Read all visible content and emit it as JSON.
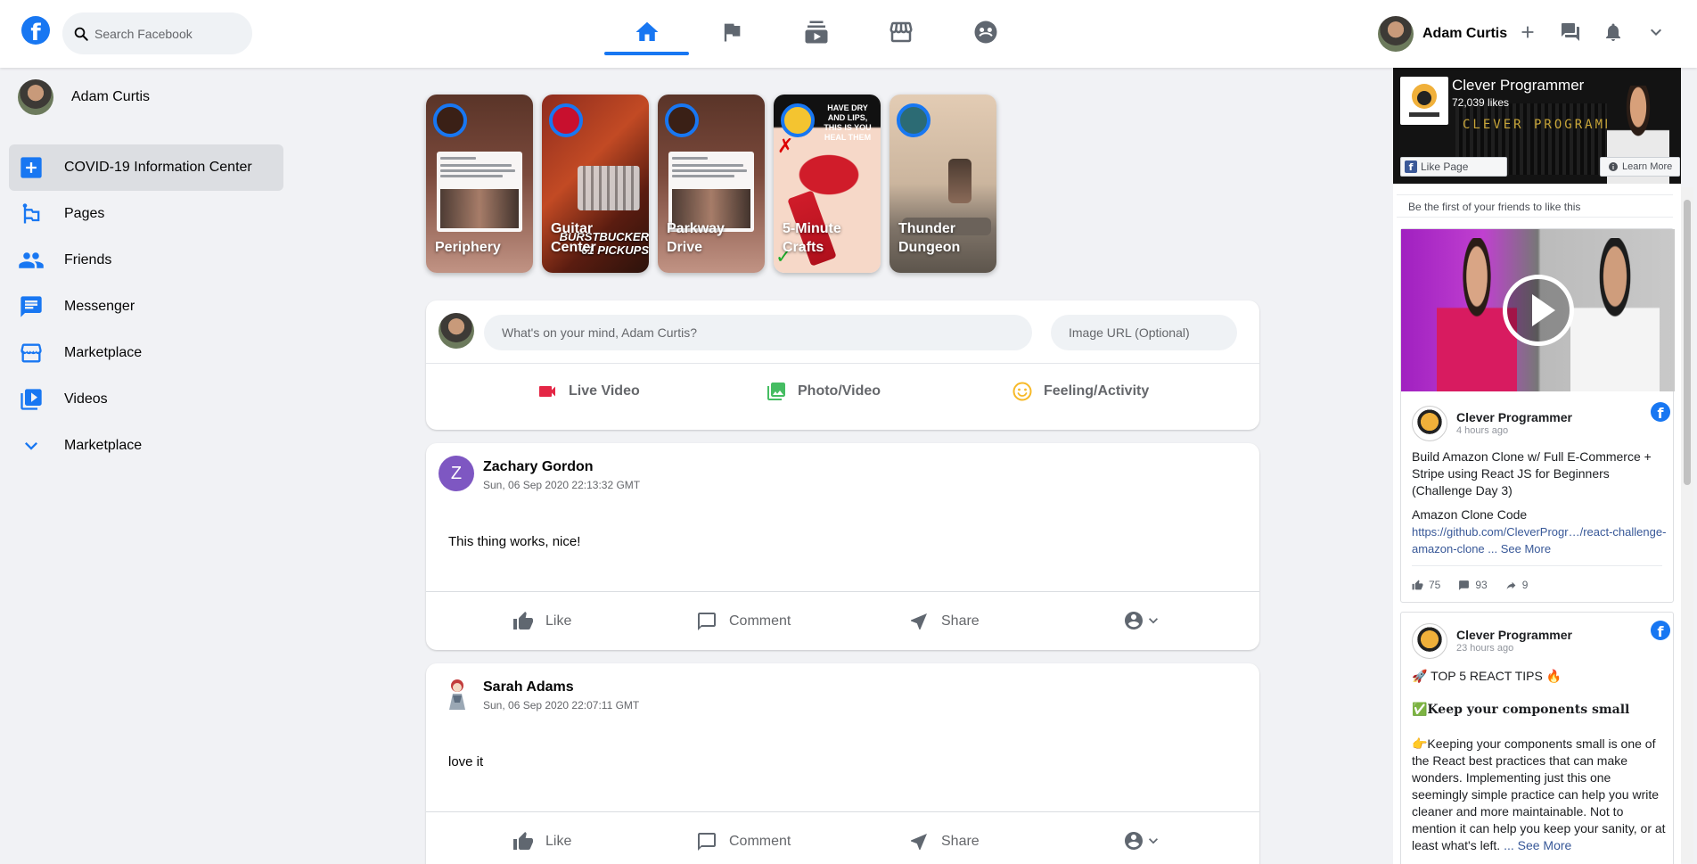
{
  "header": {
    "search_placeholder": "Search Facebook",
    "profile_name": "Adam Curtis",
    "nav_icons": [
      "home-icon",
      "flag-icon",
      "subscriptions-icon",
      "storefront-icon",
      "groups-icon"
    ],
    "right_icons": [
      "add-icon",
      "forum-icon",
      "notifications-icon",
      "expand-more-icon"
    ]
  },
  "sidebar": {
    "items": [
      {
        "label": "Adam Curtis",
        "icon": "avatar"
      },
      {
        "label": "COVID-19 Information Center",
        "icon": "local-hospital-icon"
      },
      {
        "label": "Pages",
        "icon": "emoji-flags-icon"
      },
      {
        "label": "Friends",
        "icon": "people-icon"
      },
      {
        "label": "Messenger",
        "icon": "chat-icon"
      },
      {
        "label": "Marketplace",
        "icon": "storefront-icon"
      },
      {
        "label": "Videos",
        "icon": "video-library-icon"
      },
      {
        "label": "Marketplace",
        "icon": "expand-more-icon"
      }
    ]
  },
  "stories": [
    {
      "label": "Periphery"
    },
    {
      "label": "Guitar Center"
    },
    {
      "label": "Parkway Drive"
    },
    {
      "label": "5-Minute Crafts"
    },
    {
      "label": "Thunder Dungeon"
    }
  ],
  "story_overlays": {
    "guitar": "BURSTBUCKER '61 PICKUPS",
    "crafts": "HAVE DRY AND LIPS, THIS IS YOU HEAL THEM"
  },
  "composer": {
    "message_placeholder": "What's on your mind, Adam Curtis?",
    "image_placeholder": "Image URL (Optional)",
    "options": [
      {
        "label": "Live Video",
        "icon": "videocam-icon",
        "color": "#e42645"
      },
      {
        "label": "Photo/Video",
        "icon": "photo-library-icon",
        "color": "#45bd62"
      },
      {
        "label": "Feeling/Activity",
        "icon": "insert-emoticon-icon",
        "color": "#f7b928"
      }
    ]
  },
  "posts": [
    {
      "author": "Zachary Gordon",
      "initial": "Z",
      "timestamp": "Sun, 06 Sep 2020 22:13:32 GMT",
      "message": "This thing works, nice!"
    },
    {
      "author": "Sarah Adams",
      "timestamp": "Sun, 06 Sep 2020 22:07:11 GMT",
      "message": "love it"
    }
  ],
  "post_actions": {
    "like": "Like",
    "comment": "Comment",
    "share": "Share"
  },
  "widget": {
    "page_name": "Clever Programmer",
    "likes": "72,039 likes",
    "like_page_label": "Like Page",
    "learn_more_label": "Learn More",
    "friends_note": "Be the first of your friends to like this",
    "cover_text": "CLEVER PROGRAMMER",
    "post1": {
      "author": "Clever Programmer",
      "time": "4 hours ago",
      "text": "Build Amazon Clone w/ Full E-Commerce + Stripe using React JS for Beginners (Challenge Day 3)",
      "subtitle": "Amazon Clone Code",
      "link": "https://github.com/CleverProgr…/react-challenge-amazon-clone",
      "see_more": "... See More",
      "likes": "75",
      "comments": "93",
      "shares": "9"
    },
    "post2": {
      "author": "Clever Programmer",
      "time": "23 hours ago",
      "line1": "🚀 TOP 5 REACT TIPS 🔥",
      "heading": "✅Keep your components small",
      "body": "👉Keeping your components small is one of the React best practices that can make wonders. Implementing just this one seemingly simple practice can help you write cleaner and more maintainable. Not to mention it can help you keep your sanity, or at least what's left.",
      "see_more": "... See More"
    }
  },
  "colors": {
    "brand": "#1877f2",
    "background": "#f1f2f5",
    "text_secondary": "#65676b"
  }
}
